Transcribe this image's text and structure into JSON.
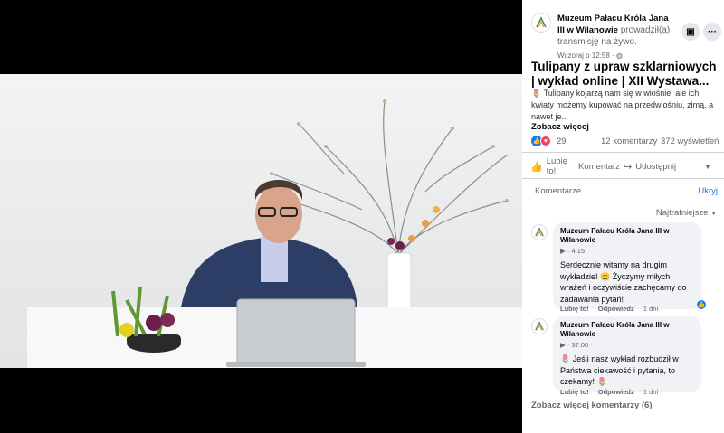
{
  "post": {
    "page_name": "Muzeum Pałacu Króla Jana III w Wilanowie",
    "action_text": "prowadził(a) transmisję na żywo.",
    "time": "Wczoraj o 12:58 ·",
    "title": "Tulipany z upraw szklarniowych | wykład online | XII Wystawa...",
    "body_emoji": "🌷",
    "body": "Tulipany kojarzą nam się w wiośnie, ale ich kwiaty możemy kupować na przedwiośniu, zimą, a nawet je...",
    "see_more": "Zobacz więcej"
  },
  "stats": {
    "reactions": "29",
    "comments": "12 komentarzy",
    "views": "372 wyświetleń"
  },
  "actions": {
    "like": "Lubię to!",
    "comment": "Komentarz",
    "share": "Udostępnij"
  },
  "comments_section": {
    "title": "Komentarze",
    "hide": "Ukryj",
    "sort": "Najtrafniejsze",
    "items": [
      {
        "author": "Muzeum Pałacu Króla Jana III w Wilanowie",
        "timestamp": "4:15",
        "text": "Serdecznie witamy na drugim wykładzie! 😀 Życzymy miłych wrażeń i oczywiście zachęcamy do zadawania pytań!",
        "like": "Lubię to!",
        "reply": "Odpowiedz",
        "age": "1 dni"
      },
      {
        "author": "Muzeum Pałacu Króla Jana III w Wilanowie",
        "timestamp": "37:00",
        "text": "🌷 Jeśli nasz wykład rozbudził w Państwa ciekawość i pytania, to czekamy! 🌷",
        "like": "Lubię to!",
        "reply": "Odpowiedz",
        "age": "1 dni"
      }
    ],
    "more": "Zobacz więcej komentarzy (6)"
  },
  "colors": {
    "accent": "#1877f2",
    "love": "#f33e58",
    "bubble": "#f0f2f5",
    "muted": "#65676b"
  }
}
